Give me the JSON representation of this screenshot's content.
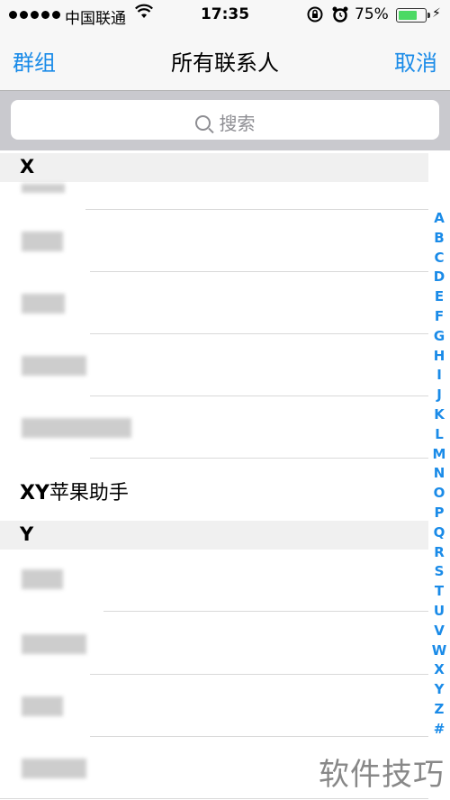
{
  "status_bar": {
    "carrier": "中国联通",
    "time": "17:35",
    "battery_percent": "75%",
    "battery_level": 0.75,
    "battery_color": "#4cd964"
  },
  "nav": {
    "left_button": "群组",
    "title": "所有联系人",
    "right_button": "取消",
    "accent_color": "#1a8be8"
  },
  "search": {
    "placeholder": "搜索"
  },
  "sections": [
    {
      "letter": "X"
    },
    {
      "letter": "Y"
    }
  ],
  "contacts": {
    "visible_name": "XY苹果助手",
    "visible_name_latin": "XY",
    "visible_name_cn": "苹果助手"
  },
  "index_letters": [
    "A",
    "B",
    "C",
    "D",
    "E",
    "F",
    "G",
    "H",
    "I",
    "J",
    "K",
    "L",
    "M",
    "N",
    "O",
    "P",
    "Q",
    "R",
    "S",
    "T",
    "U",
    "V",
    "W",
    "X",
    "Y",
    "Z",
    "#"
  ],
  "watermark": "软件技巧"
}
